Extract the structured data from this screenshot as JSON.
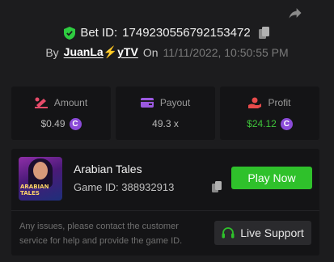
{
  "header": {
    "bet_id_label": "Bet ID:",
    "bet_id": "1749230556792153472",
    "by_label": "By",
    "user_part1": "JuanLa",
    "user_bolt": "⚡",
    "user_part2": "yTV",
    "on_label": "On",
    "date": "11/11/2022, 10:50:55 PM"
  },
  "stats": [
    {
      "label": "Amount",
      "value": "$0.49",
      "coin": "C",
      "icon": "money-icon"
    },
    {
      "label": "Payout",
      "value": "49.3 x",
      "icon": "wallet-icon"
    },
    {
      "label": "Profit",
      "value": "$24.12",
      "coin": "C",
      "icon": "hand-coin-icon"
    }
  ],
  "game": {
    "thumb_title": "ARABIAN TALES",
    "name": "Arabian Tales",
    "id_label": "Game ID:",
    "id": "388932913",
    "play_label": "Play Now"
  },
  "support": {
    "message": "Any issues, please contact the customer service for help and provide the game ID.",
    "button_label": "Live Support"
  },
  "colors": {
    "background": "#1c1c1e",
    "card": "#141416",
    "accent_green": "#2fc12b",
    "coin_purple": "#8b4bd8",
    "verified_green": "#2ecc40",
    "amount_icon": "#e84b6a",
    "payout_icon": "#9b59e0",
    "profit_icon": "#e84b4b"
  }
}
